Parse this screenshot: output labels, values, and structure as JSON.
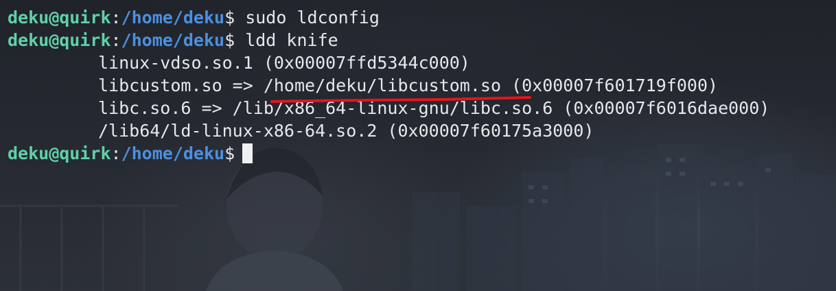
{
  "terminal": {
    "lines": [
      {
        "user": "deku@quirk",
        "sep": ":",
        "path": "/home/deku",
        "prompt_char": "$",
        "command": " sudo ldconfig"
      },
      {
        "user": "deku@quirk",
        "sep": ":",
        "path": "/home/deku",
        "prompt_char": "$",
        "command": " ldd knife"
      }
    ],
    "output": [
      "linux-vdso.so.1 (0x00007ffd5344c000)",
      "libcustom.so => /home/deku/libcustom.so (0x00007f601719f000)",
      "libc.so.6 => /lib/x86_64-linux-gnu/libc.so.6 (0x00007f6016dae000)",
      "/lib64/ld-linux-x86-64.so.2 (0x00007f60175a3000)"
    ],
    "current_prompt": {
      "user": "deku@quirk",
      "sep": ":",
      "path": "/home/deku",
      "prompt_char": "$"
    }
  },
  "colors": {
    "user": "#5fd1a8",
    "path": "#4b90e0",
    "text": "#e6e8ec",
    "annotation": "#e8141c"
  }
}
